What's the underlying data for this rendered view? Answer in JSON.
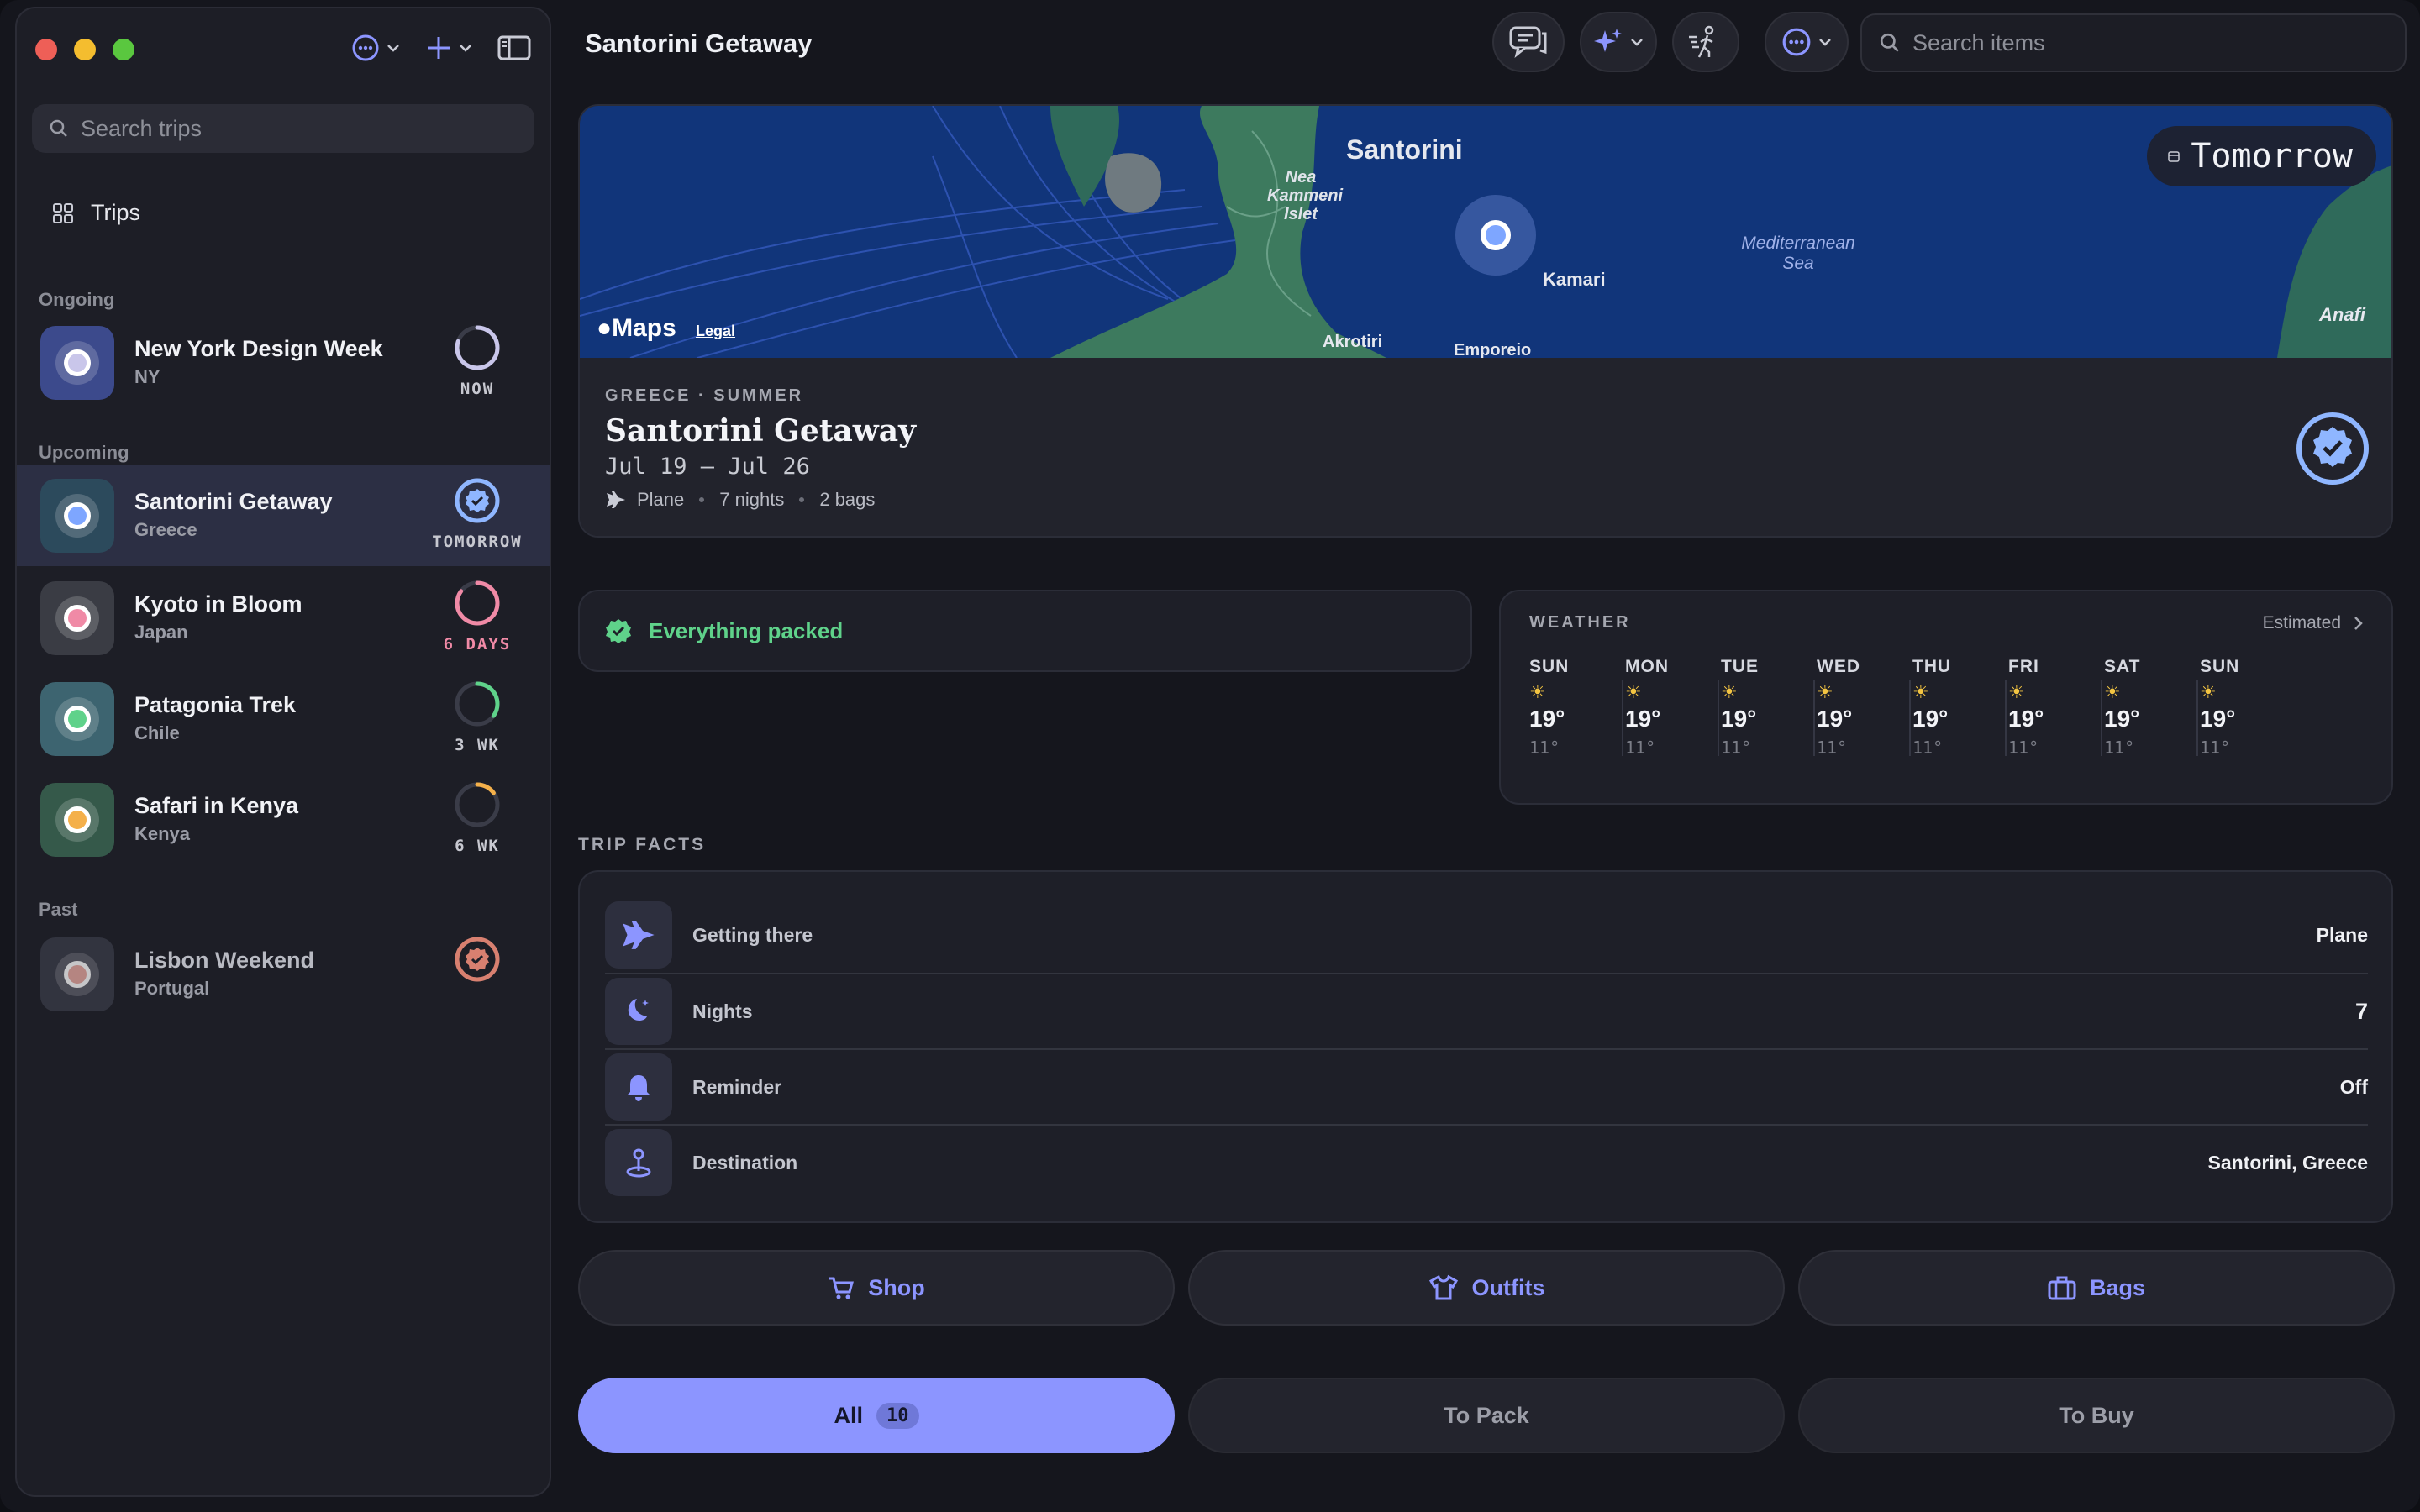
{
  "sidebar": {
    "search_placeholder": "Search trips",
    "trips_label": "Trips",
    "sections": {
      "ongoing": "Ongoing",
      "upcoming": "Upcoming",
      "past": "Past"
    },
    "trips": [
      {
        "name": "New York Design Week",
        "sub": "NY",
        "when": "NOW",
        "ring_color": "#c9c6ea",
        "thumb": "#3c4a8c",
        "dot": "#c9c6ea",
        "progress": 0.8
      },
      {
        "name": "Santorini Getaway",
        "sub": "Greece",
        "when": "TOMORROW",
        "ring_color": "#8fb6ff",
        "thumb": "#2c4a5c",
        "dot": "#7ea6ff",
        "progress": 1.0
      },
      {
        "name": "Kyoto in Bloom",
        "sub": "Japan",
        "when": "6 DAYS",
        "ring_color": "#f08aa6",
        "thumb": "#3a3c44",
        "dot": "#f08aa6",
        "progress": 0.85
      },
      {
        "name": "Patagonia Trek",
        "sub": "Chile",
        "when": "3 WK",
        "ring_color": "#5fd28a",
        "thumb": "#3d6470",
        "dot": "#5fd28a",
        "progress": 0.35
      },
      {
        "name": "Safari in Kenya",
        "sub": "Kenya",
        "when": "6 WK",
        "ring_color": "#f4b04a",
        "thumb": "#35594a",
        "dot": "#f4b04a",
        "progress": 0.15
      },
      {
        "name": "Lisbon Weekend",
        "sub": "Portugal",
        "when": "",
        "ring_color": "#d88070",
        "thumb": "#3a3c48",
        "dot": "#e8a8a0",
        "progress": 1.0
      }
    ]
  },
  "header": {
    "title": "Santorini Getaway",
    "search_placeholder": "Search items"
  },
  "map": {
    "place_labels": {
      "santorini": "Santorini",
      "nea_kammeni": "Nea Kammeni Islet",
      "kamari": "Kamari",
      "akrotiri": "Akrotiri",
      "emporeio": "Emporeio",
      "anafi": "Anafi",
      "sea": "Mediterranean Sea"
    },
    "badge": "Tomorrow",
    "logo": "Maps",
    "legal": "Legal"
  },
  "trip": {
    "category": "GREECE · SUMMER",
    "title": "Santorini Getaway",
    "dates": "Jul 19 — Jul 26",
    "transport": "Plane",
    "nights": "7 nights",
    "bags": "2 bags"
  },
  "packed": {
    "label": "Everything packed"
  },
  "weather": {
    "title": "WEATHER",
    "estimated": "Estimated",
    "days": [
      {
        "d": "SUN",
        "hi": "19°",
        "lo": "11°"
      },
      {
        "d": "MON",
        "hi": "19°",
        "lo": "11°"
      },
      {
        "d": "TUE",
        "hi": "19°",
        "lo": "11°"
      },
      {
        "d": "WED",
        "hi": "19°",
        "lo": "11°"
      },
      {
        "d": "THU",
        "hi": "19°",
        "lo": "11°"
      },
      {
        "d": "FRI",
        "hi": "19°",
        "lo": "11°"
      },
      {
        "d": "SAT",
        "hi": "19°",
        "lo": "11°"
      },
      {
        "d": "SUN",
        "hi": "19°",
        "lo": "11°"
      }
    ]
  },
  "facts": {
    "title": "TRIP FACTS",
    "rows": [
      {
        "label": "Getting there",
        "value": "Plane",
        "icon": "plane-icon"
      },
      {
        "label": "Nights",
        "value": "7",
        "icon": "moon-icon"
      },
      {
        "label": "Reminder",
        "value": "Off",
        "icon": "bell-icon"
      },
      {
        "label": "Destination",
        "value": "Santorini, Greece",
        "icon": "location-pin-icon"
      }
    ]
  },
  "actions": {
    "shop": "Shop",
    "outfits": "Outfits",
    "bags": "Bags"
  },
  "filters": {
    "all": "All",
    "all_count": "10",
    "to_pack": "To Pack",
    "to_buy": "To Buy"
  },
  "colors": {
    "accent": "#8c95ff",
    "success": "#5fd28a"
  }
}
